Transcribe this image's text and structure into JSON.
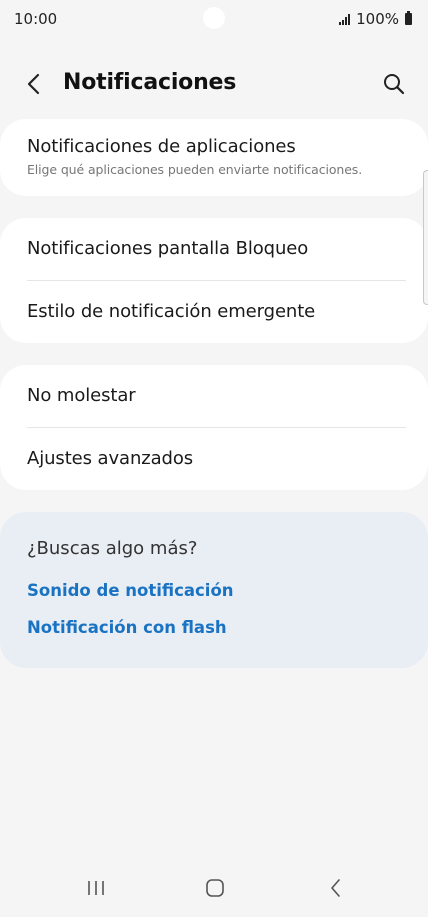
{
  "status_bar": {
    "time": "10:00",
    "battery": "100%",
    "icons": [
      "signal-icon",
      "battery-icon"
    ]
  },
  "header": {
    "title": "Notificaciones",
    "back_icon": "chevron-left-icon",
    "search_icon": "search-icon"
  },
  "settings": {
    "app_notifications": {
      "title": "Notificaciones de aplicaciones",
      "subtitle": "Elige qué aplicaciones pueden enviarte notificaciones."
    },
    "lock_screen": {
      "title": "Notificaciones pantalla Bloqueo"
    },
    "popup_style": {
      "title": "Estilo de notificación emergente"
    },
    "do_not_disturb": {
      "title": "No molestar"
    },
    "advanced": {
      "title": "Ajustes avanzados"
    }
  },
  "suggestions": {
    "title": "¿Buscas algo más?",
    "links": [
      "Sonido de notificación",
      "Notificación con flash"
    ]
  },
  "colors": {
    "background": "#f5f5f5",
    "card": "#ffffff",
    "suggestion_card": "#e9eef5",
    "link": "#1a73c2"
  },
  "nav_bar": {
    "icons": [
      "recent-apps-icon",
      "home-icon",
      "back-icon"
    ]
  }
}
